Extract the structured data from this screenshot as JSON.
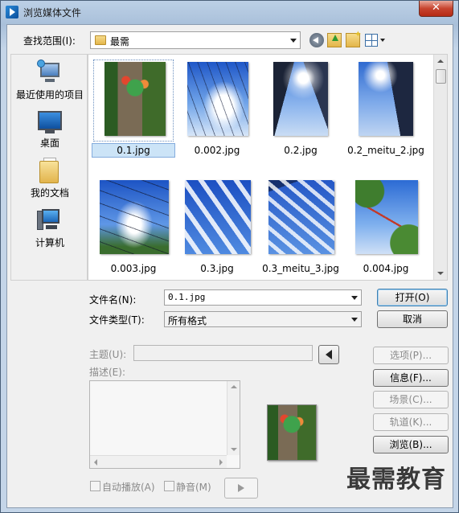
{
  "window": {
    "title": "浏览媒体文件",
    "close_label": "✕"
  },
  "lookin": {
    "label": "查找范围(I):",
    "value": "最需"
  },
  "places": [
    {
      "label": "最近使用的项目"
    },
    {
      "label": "桌面"
    },
    {
      "label": "我的文档"
    },
    {
      "label": "计算机"
    }
  ],
  "files": [
    {
      "name": "0.1.jpg"
    },
    {
      "name": "0.002.jpg"
    },
    {
      "name": "0.2.jpg"
    },
    {
      "name": "0.2_meitu_2.jpg"
    },
    {
      "name": "0.003.jpg"
    },
    {
      "name": "0.3.jpg"
    },
    {
      "name": "0.3_meitu_3.jpg"
    },
    {
      "name": "0.004.jpg"
    }
  ],
  "filename": {
    "label": "文件名(N):",
    "value": "0.1.jpg"
  },
  "filetype": {
    "label": "文件类型(T):",
    "value": "所有格式"
  },
  "buttons": {
    "open": "打开(O)",
    "cancel": "取消",
    "options": "选项(P)...",
    "info": "信息(F)...",
    "scene": "场景(C)...",
    "track": "轨道(K)...",
    "browse": "浏览(B)..."
  },
  "meta": {
    "subject_label": "主题(U):",
    "desc_label": "描述(E):"
  },
  "playback": {
    "autoplay_label": "自动播放(A)",
    "mute_label": "静音(M)"
  },
  "watermark": "最需教育",
  "colors": {
    "selection": "#cce4f7",
    "close": "#c7442f"
  }
}
